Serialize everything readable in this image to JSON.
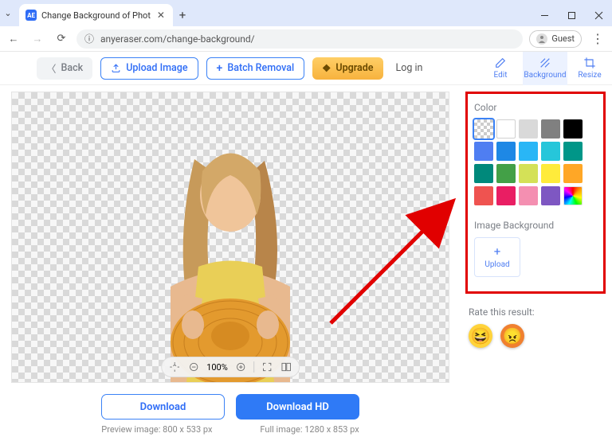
{
  "browser": {
    "tab_title": "Change Background of Phot",
    "url": "anyeraser.com/change-background/",
    "guest_label": "Guest"
  },
  "header": {
    "back": "Back",
    "upload": "Upload Image",
    "batch": "Batch Removal",
    "upgrade": "Upgrade",
    "login": "Log in",
    "tabs": {
      "edit": "Edit",
      "background": "Background",
      "resize": "Resize"
    }
  },
  "canvas": {
    "zoom": "100%",
    "download": "Download",
    "download_hd": "Download HD",
    "preview_meta": "Preview image: 800 x 533 px",
    "full_meta": "Full image: 1280 x 853 px"
  },
  "sidebar": {
    "color_label": "Color",
    "image_bg_label": "Image Background",
    "upload_label": "Upload",
    "colors": [
      "transparent",
      "white",
      "#d9d9d9",
      "#808080",
      "#000000",
      "#4f7ef2",
      "#1e88e5",
      "#29b6f6",
      "#26c6da",
      "#009688",
      "#00897b",
      "#43a047",
      "#d4e157",
      "#ffeb3b",
      "#ffa726",
      "#ef5350",
      "#e91e63",
      "#f48fb1",
      "#7e57c2",
      "rainbow"
    ]
  },
  "rate": {
    "label": "Rate this result:"
  }
}
